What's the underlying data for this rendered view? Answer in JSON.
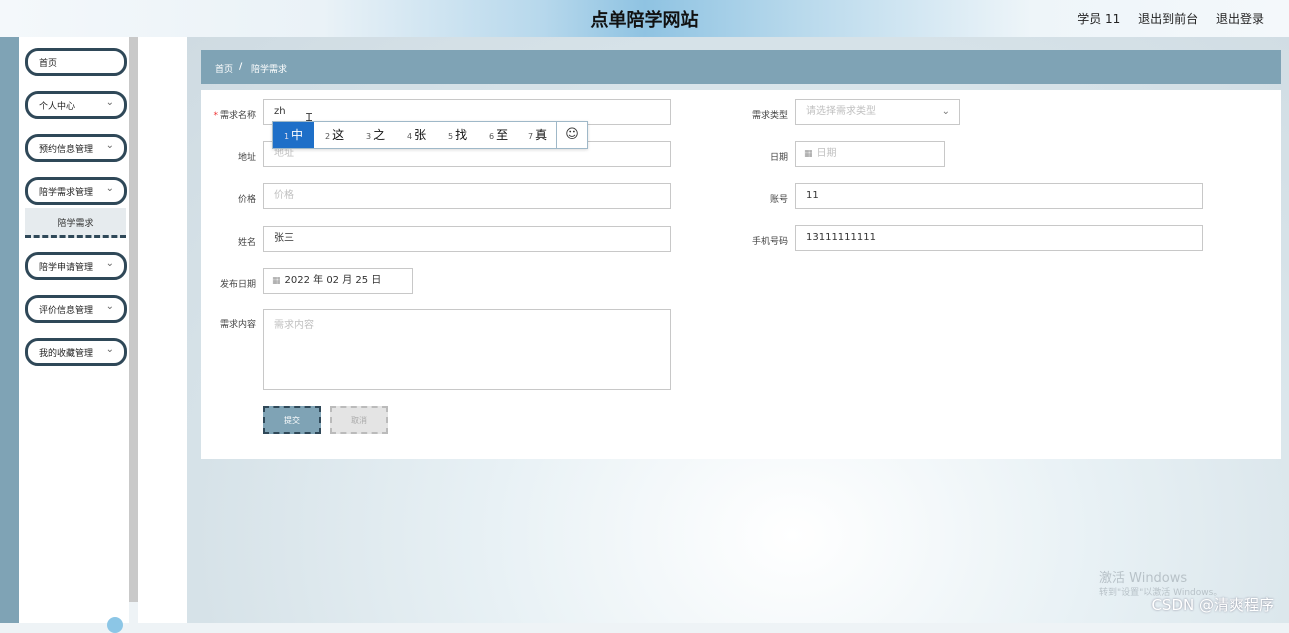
{
  "header": {
    "site_title": "点单陪学网站",
    "user_label": "学员 11",
    "front_link": "退出到前台",
    "logout_link": "退出登录"
  },
  "sidebar": {
    "items": [
      {
        "label": "首页",
        "has_chevron": false
      },
      {
        "label": "个人中心",
        "has_chevron": true
      },
      {
        "label": "预约信息管理",
        "has_chevron": true
      },
      {
        "label": "陪学需求管理",
        "has_chevron": true
      },
      {
        "label": "陪学申请管理",
        "has_chevron": true
      },
      {
        "label": "评价信息管理",
        "has_chevron": true
      },
      {
        "label": "我的收藏管理",
        "has_chevron": true
      }
    ],
    "active_submenu": "陪学需求",
    "chevron_icon": "chevron-down-icon"
  },
  "breadcrumb": {
    "home": "首页",
    "separator": "/",
    "current": "陪学需求"
  },
  "form": {
    "demand_name": {
      "label": "需求名称",
      "value": "zh",
      "required": true
    },
    "address": {
      "label": "地址",
      "placeholder": "地址"
    },
    "price": {
      "label": "价格",
      "placeholder": "价格"
    },
    "name": {
      "label": "姓名",
      "value": "张三"
    },
    "publish_date": {
      "label": "发布日期",
      "value": "2022 年 02 月 25 日"
    },
    "demand_content": {
      "label": "需求内容",
      "placeholder": "需求内容"
    },
    "demand_type": {
      "label": "需求类型",
      "placeholder": "请选择需求类型"
    },
    "date": {
      "label": "日期",
      "placeholder": "日期"
    },
    "account": {
      "label": "账号",
      "value": "11"
    },
    "phone": {
      "label": "手机号码",
      "value": "13111111111"
    },
    "submit_label": "提交",
    "cancel_label": "取消"
  },
  "ime": {
    "candidates": [
      {
        "num": "1",
        "text": "中"
      },
      {
        "num": "2",
        "text": "这"
      },
      {
        "num": "3",
        "text": "之"
      },
      {
        "num": "4",
        "text": "张"
      },
      {
        "num": "5",
        "text": "找"
      },
      {
        "num": "6",
        "text": "至"
      },
      {
        "num": "7",
        "text": "真"
      }
    ],
    "emoji_icon": "smiley-icon",
    "selected_index": 0
  },
  "overlay": {
    "windows_line1": "激活 Windows",
    "windows_line2": "转到\"设置\"以激活 Windows。",
    "csdn": "CSDN @清爽程序"
  },
  "colors": {
    "accent": "#7fa3b5",
    "border_dark": "#2f4858",
    "ime_selected": "#1e6fc8",
    "required": "#e33333"
  }
}
